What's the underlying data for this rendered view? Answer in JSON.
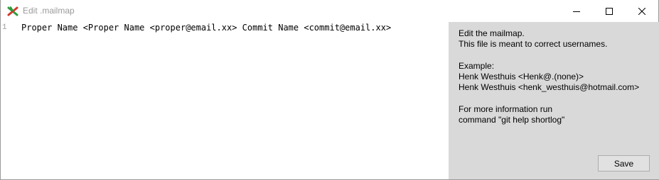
{
  "window": {
    "title": "Edit .mailmap"
  },
  "editor": {
    "lines": [
      {
        "number": "1",
        "text": "Proper Name <Proper Name <proper@email.xx> Commit Name <commit@email.xx>"
      }
    ]
  },
  "help": {
    "lines": [
      "Edit the mailmap.",
      "This file is meant to correct usernames.",
      "",
      "Example:",
      "Henk Westhuis <Henk@.(none)>",
      "Henk Westhuis <henk_westhuis@hotmail.com>",
      "",
      "For more information run",
      "command \"git help shortlog\""
    ],
    "save_label": "Save"
  },
  "colors": {
    "panel_background": "#d9d9d9",
    "title_text": "#9a9a9a",
    "app_icon_green": "#2e9b3c",
    "app_icon_red": "#d03a2a"
  },
  "icons": {
    "app": "git-extensions-icon",
    "minimize": "minimize-icon",
    "maximize": "maximize-icon",
    "close": "close-icon"
  }
}
